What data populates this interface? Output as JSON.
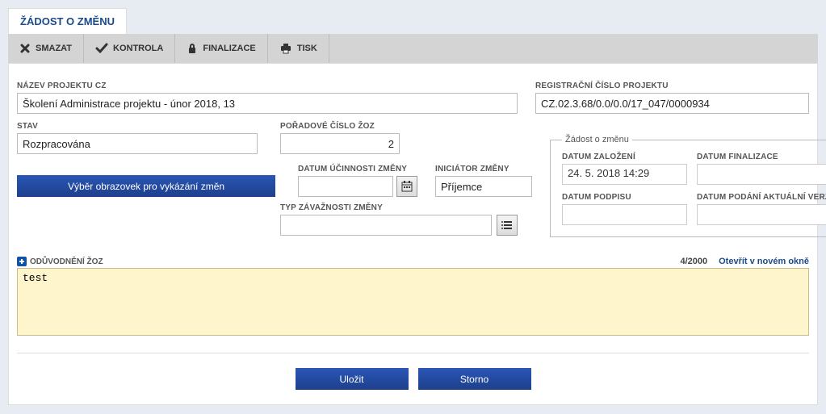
{
  "tab_title": "ŽÁDOST O ZMĚNU",
  "toolbar": {
    "delete": "SMAZAT",
    "check": "KONTROLA",
    "finalize": "FINALIZACE",
    "print": "TISK"
  },
  "form": {
    "project_name": {
      "label": "NÁZEV PROJEKTU CZ",
      "value": "Školení Administrace projektu - únor 2018, 13"
    },
    "reg_no": {
      "label": "REGISTRAČNÍ ČÍSLO PROJEKTU",
      "value": "CZ.02.3.68/0.0/0.0/17_047/0000934"
    },
    "state": {
      "label": "STAV",
      "value": "Rozpracována"
    },
    "seq_no": {
      "label": "POŘADOVÉ ČÍSLO ŽOZ",
      "value": "2"
    },
    "select_screens_btn": "Výběr obrazovek pro vykázání změn",
    "eff_date": {
      "label": "DATUM ÚČINNOSTI ZMĚNY",
      "value": ""
    },
    "initiator": {
      "label": "INICIÁTOR ZMĚNY",
      "value": "Příjemce"
    },
    "severity": {
      "label": "TYP ZÁVAŽNOSTI ZMĚNY",
      "value": ""
    }
  },
  "request_box": {
    "legend": "Žádost o změnu",
    "created": {
      "label": "DATUM ZALOŽENÍ",
      "value": "24. 5. 2018 14:29"
    },
    "finalized": {
      "label": "DATUM FINALIZACE",
      "value": ""
    },
    "signed": {
      "label": "DATUM PODPISU",
      "value": ""
    },
    "submitted": {
      "label": "DATUM PODÁNÍ AKTUÁLNÍ VERZE ŽÁDOSTI",
      "value": ""
    }
  },
  "justification": {
    "label": "ODŮVODNĚNÍ ŽOZ",
    "value": "test",
    "counter": "4/2000",
    "open_new": "Otevřít v novém okně"
  },
  "buttons": {
    "save": "Uložit",
    "cancel": "Storno"
  }
}
